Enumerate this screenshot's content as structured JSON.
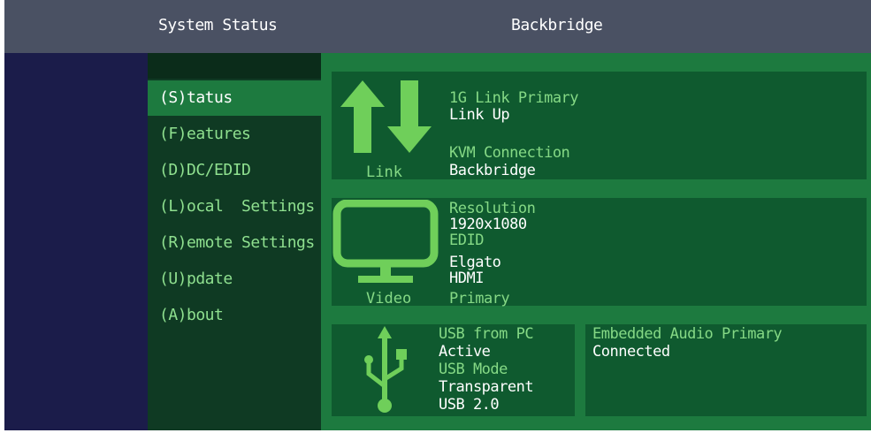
{
  "header": {
    "left_title": "System Status",
    "right_title": "Backbridge"
  },
  "sidebar": {
    "items": [
      {
        "label": "(S)tatus",
        "active": true
      },
      {
        "label": "(F)eatures",
        "active": false
      },
      {
        "label": "(D)DC/EDID",
        "active": false
      },
      {
        "label": "(L)ocal  Settings",
        "active": false
      },
      {
        "label": "(R)emote Settings",
        "active": false
      },
      {
        "label": "(U)pdate",
        "active": false
      },
      {
        "label": "(A)bout",
        "active": false
      }
    ]
  },
  "link_panel": {
    "icon": "up-down-arrows-icon",
    "caption": "Link",
    "primary_label": "1G Link Primary",
    "primary_value": "Link Up",
    "kvm_label": "KVM Connection",
    "kvm_value": "Backbridge"
  },
  "video_panel": {
    "icon": "monitor-icon",
    "caption": "Video",
    "resolution_label": "Resolution",
    "resolution_value": "1920x1080",
    "edid_label": "EDID",
    "edid_value1": "Elgato",
    "edid_value2": "HDMI",
    "edid_value3": "Primary"
  },
  "usb_panel": {
    "icon": "usb-icon",
    "usb_label": "USB from PC",
    "usb_value": "Active",
    "mode_label": "USB Mode",
    "mode_value1": "Transparent",
    "mode_value2": "USB 2.0"
  },
  "audio_panel": {
    "label": "Embedded Audio Primary",
    "value": "Connected"
  },
  "colors": {
    "header_bg": "#4a5163",
    "frame_bg": "#1b1c4a",
    "sidebar_bg": "#0f3a23",
    "active_bg": "#1d7a3f",
    "panel_bg": "#0f5a2f",
    "icon_green": "#6fcf5a",
    "label_green": "#85d985"
  }
}
